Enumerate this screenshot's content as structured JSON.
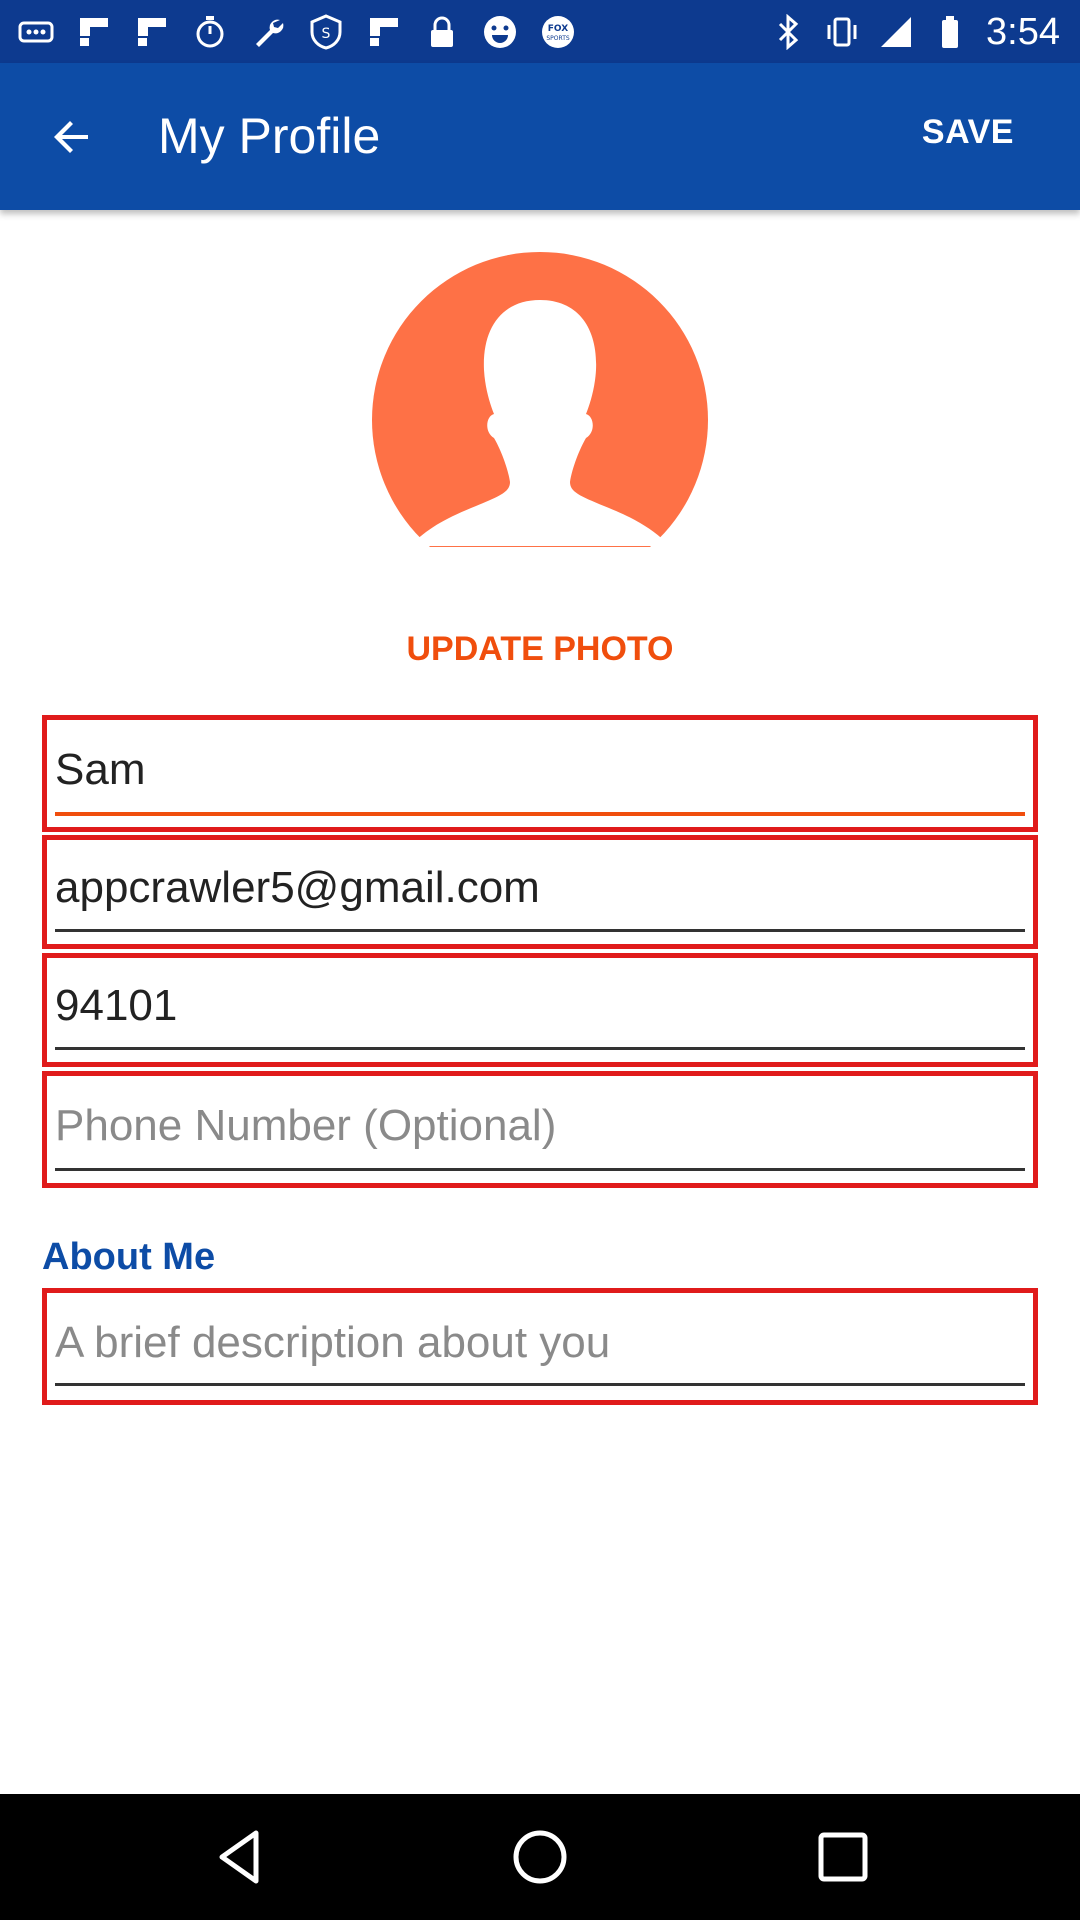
{
  "status_bar": {
    "time": "3:54",
    "icons_left": [
      "more-icon",
      "flipboard-icon",
      "flipboard-icon",
      "timer-icon",
      "wrench-icon",
      "s-badge-icon",
      "flipboard-icon",
      "lock-icon",
      "smiley-icon",
      "fox-sports-icon"
    ],
    "icons_right": [
      "bluetooth-icon",
      "vibrate-icon",
      "signal-icon",
      "battery-icon"
    ]
  },
  "app_bar": {
    "title": "My Profile",
    "save_label": "SAVE"
  },
  "profile": {
    "update_photo_label": "UPDATE PHOTO"
  },
  "form": {
    "name_value": "Sam",
    "email_value": "appcrawler5@gmail.com",
    "zip_value": "94101",
    "phone_placeholder": "Phone Number (Optional)",
    "about_label": "About Me",
    "about_placeholder": "A brief description about you"
  },
  "colors": {
    "app_bar": "#0d4ca6",
    "status_bar": "#0d3a8f",
    "accent": "#f04e0d",
    "field_border": "#e01b1b"
  }
}
